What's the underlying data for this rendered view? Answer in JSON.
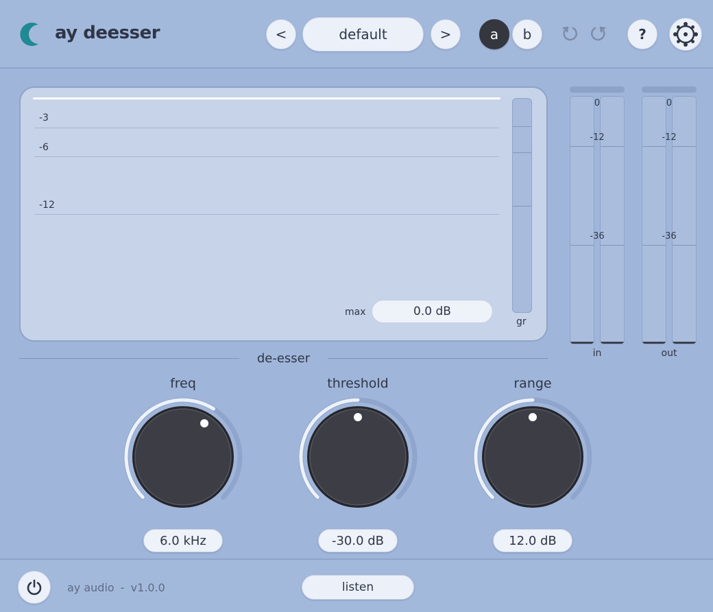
{
  "app": {
    "title": "ay deesser",
    "accent": "#2a8a96"
  },
  "header": {
    "prev_label": "<",
    "preset_name": "default",
    "next_label": ">",
    "ab": {
      "a_label": "a",
      "b_label": "b",
      "active": "a"
    },
    "undo_icon": "undo-icon",
    "redo_icon": "redo-icon",
    "help_label": "?",
    "settings_icon": "gear-icon"
  },
  "display": {
    "grid_labels": [
      "-3",
      "-6",
      "-12"
    ],
    "max_label": "max",
    "max_value": "0.0 dB",
    "gr_label": "gr"
  },
  "meters": {
    "scale": [
      "0",
      "-12",
      "-36"
    ],
    "in_label": "in",
    "out_label": "out"
  },
  "section": {
    "title": "de-esser"
  },
  "knobs": [
    {
      "label": "freq",
      "value": "6.0 kHz",
      "level": 0.62
    },
    {
      "label": "threshold",
      "value": "-30.0 dB",
      "level": 0.5
    },
    {
      "label": "range",
      "value": "12.0 dB",
      "level": 0.5
    }
  ],
  "footer": {
    "power_icon": "power-icon",
    "brand": "ay audio",
    "separator": "-",
    "version": "v1.0.0",
    "listen_label": "listen"
  }
}
